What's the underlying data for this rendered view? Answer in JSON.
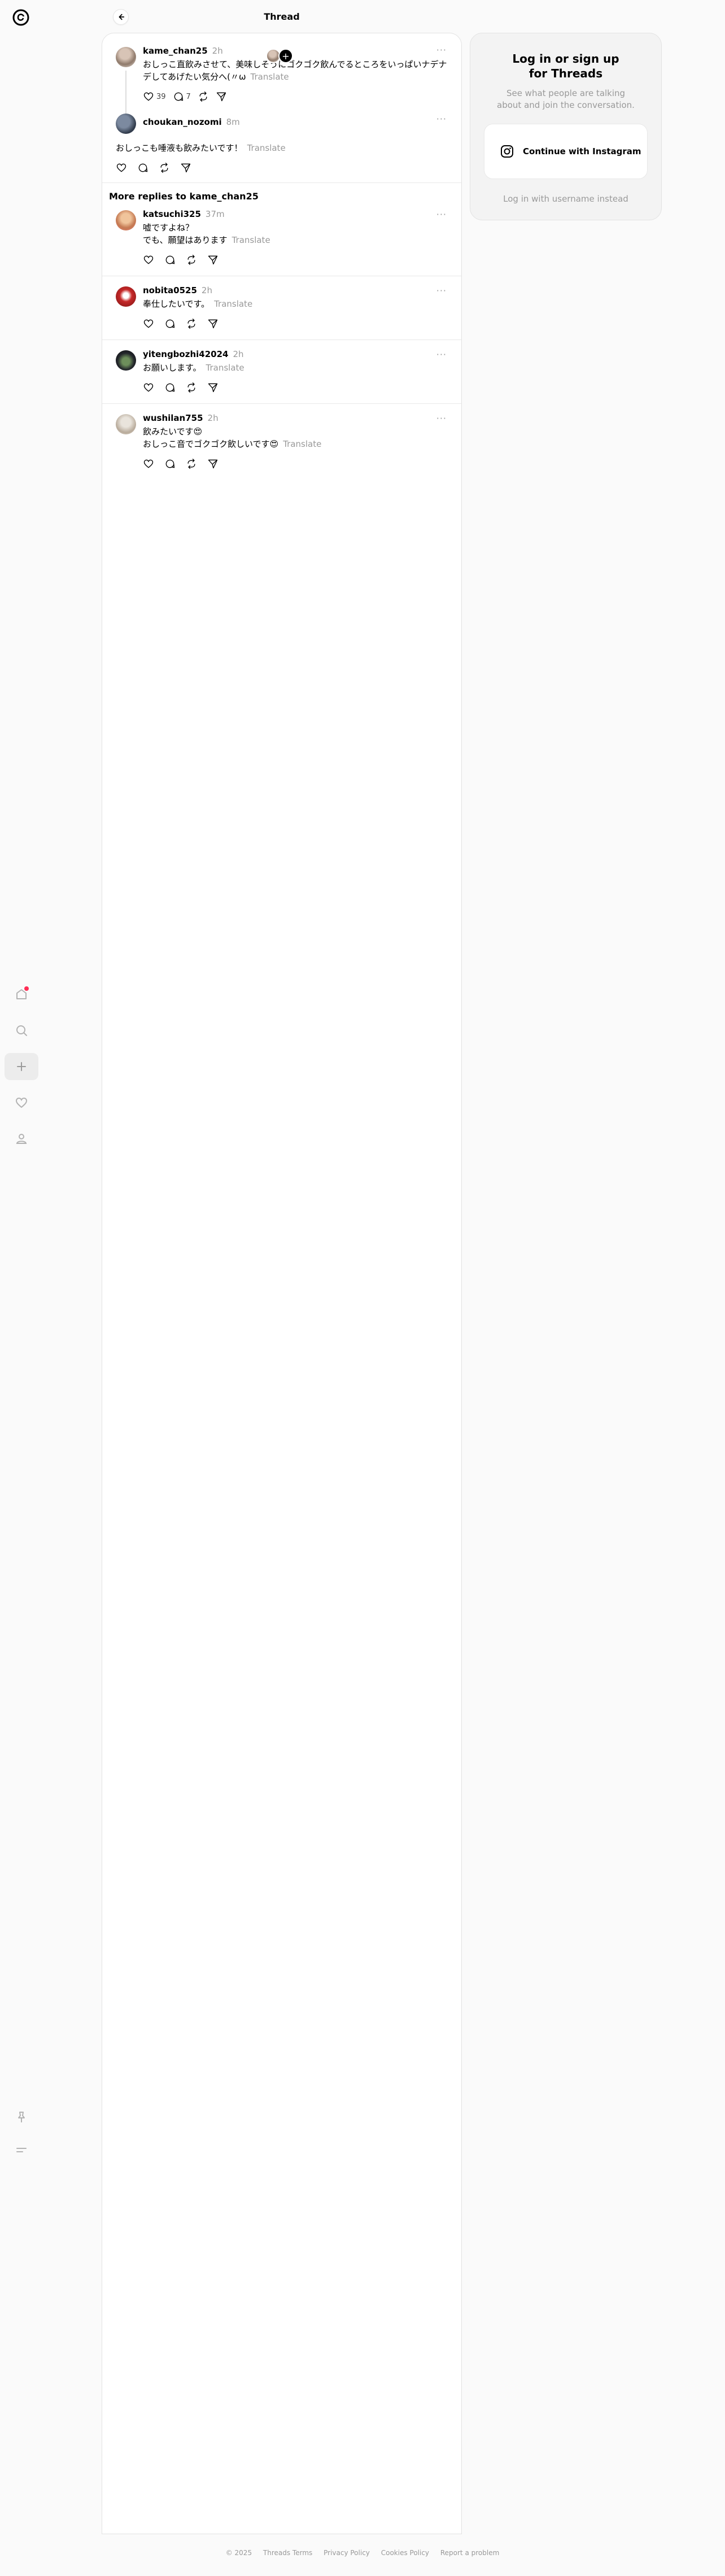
{
  "header": {
    "title": "Thread"
  },
  "rail": {
    "icons": [
      "threads-logo-icon",
      "home-icon",
      "search-icon",
      "create-icon",
      "heart-icon",
      "profile-icon",
      "pin-icon",
      "menu-icon"
    ]
  },
  "main_post": {
    "username": "kame_chan25",
    "time": "2h",
    "text": "おしっこ直飲みさせて、美味しそうにゴクゴク飲んでるところをいっぱいナデナデしてあげたい気分へ(〃ω",
    "translate": "Translate",
    "likes": "39",
    "replies": "7"
  },
  "reply_post": {
    "username": "choukan_nozomi",
    "time": "8m",
    "text": "おしっこも唾液も飲みたいです！",
    "translate": "Translate"
  },
  "section_title": "More replies to kame_chan25",
  "replies": [
    {
      "username": "katsuchi325",
      "time": "37m",
      "text": "嘘ですよね？\nでも、願望はあります",
      "translate": "Translate"
    },
    {
      "username": "nobita0525",
      "time": "2h",
      "text": "奉仕したいです。",
      "translate": "Translate"
    },
    {
      "username": "yitengbozhi42024",
      "time": "2h",
      "text": "お願いします。",
      "translate": "Translate"
    },
    {
      "username": "wushilan755",
      "time": "2h",
      "text": "飲みたいです😍\nおしっこ音でゴクゴク飲しいです😍",
      "translate": "Translate"
    }
  ],
  "login": {
    "title": "Log in or sign up for Threads",
    "subtitle": "See what people are talking about and join the conversation.",
    "instagram_button": "Continue with Instagram",
    "username_link": "Log in with username instead"
  },
  "footer": {
    "copyright": "© 2025",
    "terms": "Threads Terms",
    "privacy": "Privacy Policy",
    "cookies": "Cookies Policy",
    "report": "Report a problem"
  }
}
